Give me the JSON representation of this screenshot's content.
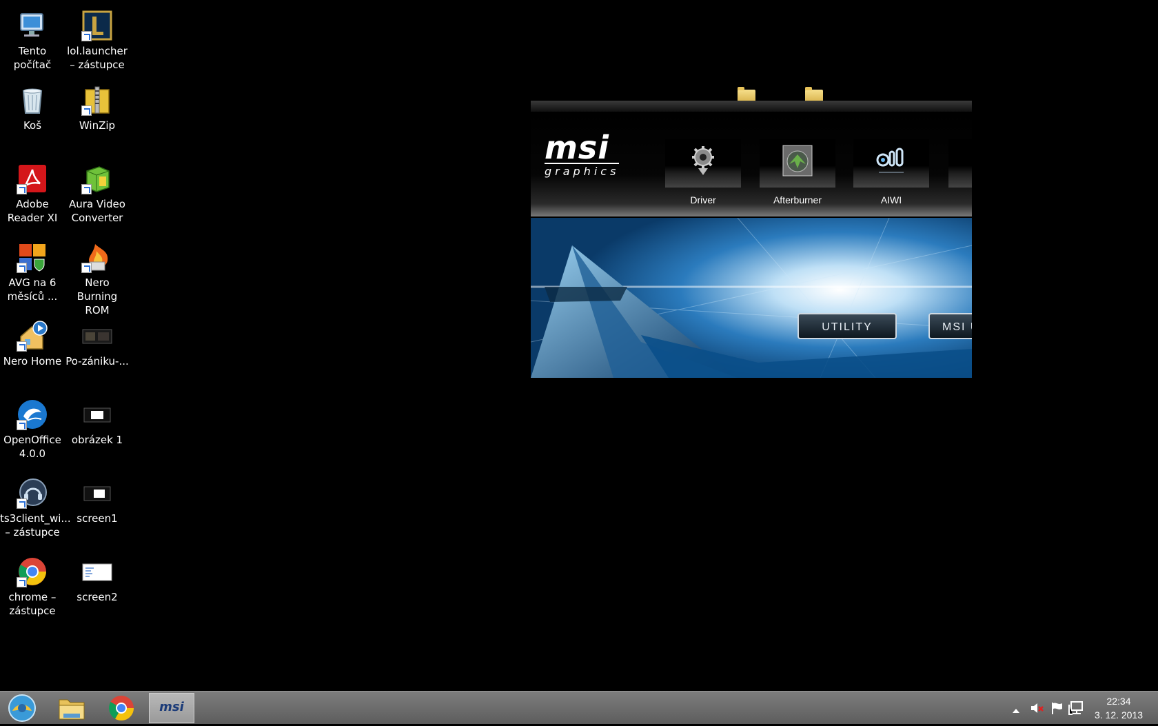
{
  "desktop": {
    "icons": [
      {
        "label": "Tento počítač"
      },
      {
        "label": "lol.launcher – zástupce"
      },
      {
        "label": "Koš"
      },
      {
        "label": "WinZip"
      },
      {
        "label": "Adobe Reader XI"
      },
      {
        "label": "Aura Video Converter"
      },
      {
        "label": "AVG na 6 měsíců ..."
      },
      {
        "label": "Nero Burning ROM"
      },
      {
        "label": "Nero Home"
      },
      {
        "label": "Po-zániku-..."
      },
      {
        "label": "OpenOffice 4.0.0"
      },
      {
        "label": "obrázek 1"
      },
      {
        "label": "ts3client_wi... – zástupce"
      },
      {
        "label": "screen1"
      },
      {
        "label": "chrome – zástupce"
      },
      {
        "label": "screen2"
      }
    ]
  },
  "msi_window": {
    "logo_main": "msi",
    "logo_sub": "graphics",
    "tools": [
      {
        "label": "Driver",
        "icon": "gear-download-icon"
      },
      {
        "label": "Afterburner",
        "icon": "afterburner-icon"
      },
      {
        "label": "AIWI",
        "icon": "aiwi-icon"
      }
    ],
    "buttons": {
      "utility": "UTILITY",
      "msi_partial": "MSI U"
    }
  },
  "taskbar": {
    "start_icon": "start-orb-icon",
    "apps": [
      {
        "name": "file-explorer",
        "icon": "folder-icon"
      },
      {
        "name": "chrome",
        "icon": "chrome-icon"
      },
      {
        "name": "msi",
        "label": "msi",
        "active": true
      }
    ],
    "clock": {
      "time": "22:34",
      "date": "3. 12. 2013"
    }
  },
  "colors": {
    "desktop_bg": "#000000",
    "taskbar": "#6a6a6a",
    "hero_blue": "#1d6fae"
  }
}
